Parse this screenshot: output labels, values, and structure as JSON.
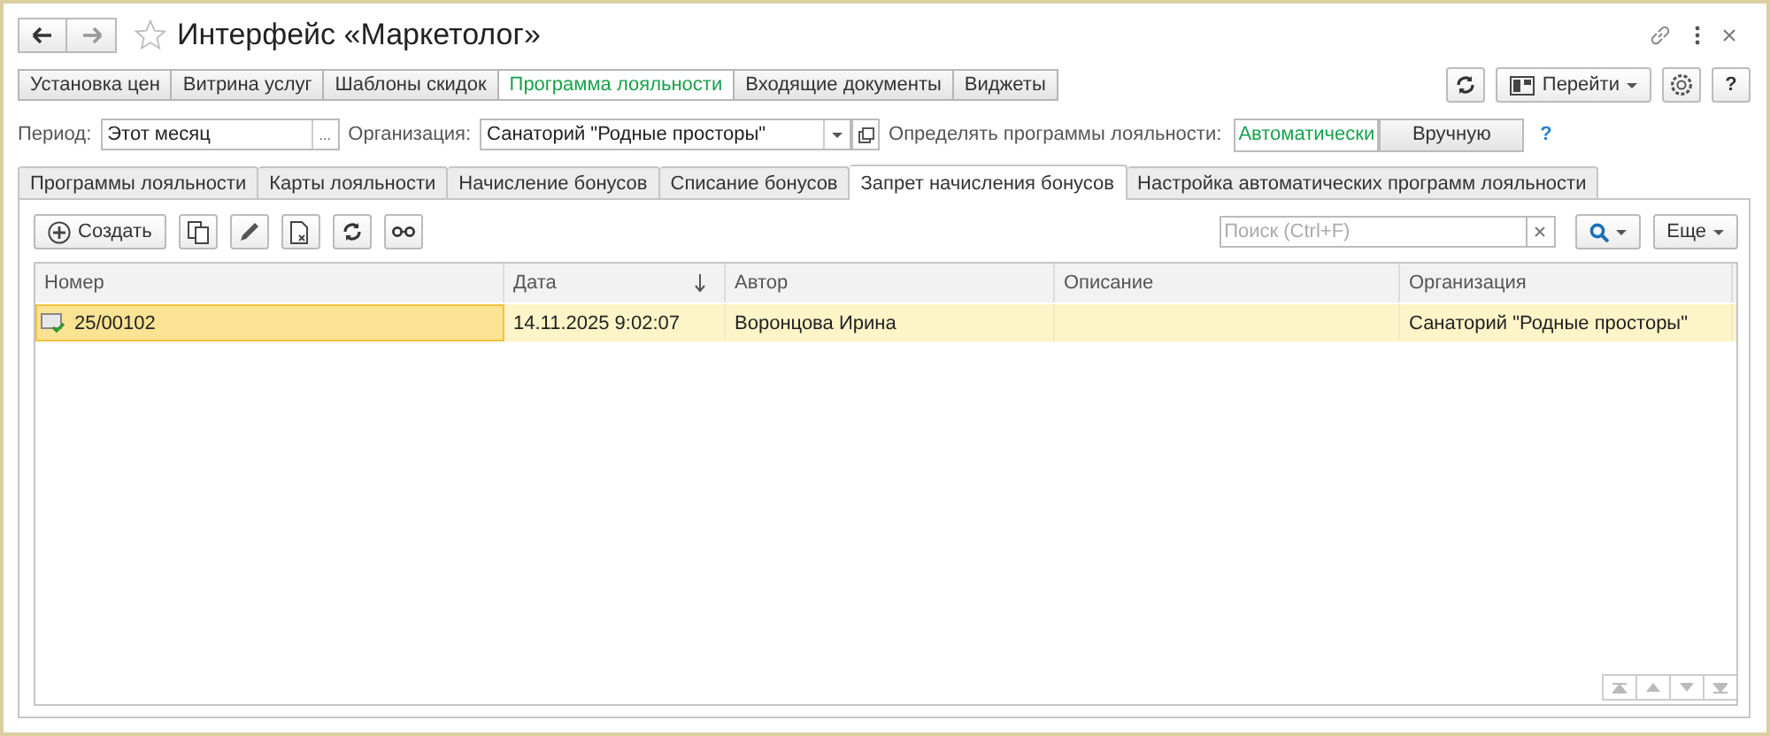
{
  "window": {
    "title": "Интерфейс «Маркетолог»"
  },
  "sections": [
    {
      "label": "Установка цен",
      "selected": false
    },
    {
      "label": "Витрина услуг",
      "selected": false
    },
    {
      "label": "Шаблоны скидок",
      "selected": false
    },
    {
      "label": "Программа лояльности",
      "selected": true
    },
    {
      "label": "Входящие документы",
      "selected": false
    },
    {
      "label": "Виджеты",
      "selected": false
    }
  ],
  "header_buttons": {
    "goto": "Перейти",
    "help": "?"
  },
  "filters": {
    "period_label": "Период:",
    "period_value": "Этот месяц",
    "period_button": "...",
    "organization_label": "Организация:",
    "organization_value": "Санаторий \"Родные просторы\"",
    "mode_label": "Определять программы лояльности:",
    "modes": [
      {
        "label": "Автоматически",
        "selected": true
      },
      {
        "label": "Вручную",
        "selected": false
      }
    ],
    "help": "?"
  },
  "tabs": [
    {
      "label": "Программы лояльности",
      "selected": false
    },
    {
      "label": "Карты лояльности",
      "selected": false
    },
    {
      "label": "Начисление бонусов",
      "selected": false
    },
    {
      "label": "Списание бонусов",
      "selected": false
    },
    {
      "label": "Запрет начисления бонусов",
      "selected": true
    },
    {
      "label": "Настройка автоматических программ лояльности",
      "selected": false
    }
  ],
  "toolbar": {
    "create": "Создать",
    "search_placeholder": "Поиск (Ctrl+F)",
    "more": "Еще"
  },
  "table": {
    "columns": [
      {
        "label": "Номер",
        "sorted": false
      },
      {
        "label": "Дата",
        "sorted": true
      },
      {
        "label": "Автор",
        "sorted": false
      },
      {
        "label": "Описание",
        "sorted": false
      },
      {
        "label": "Организация",
        "sorted": false
      }
    ],
    "rows": [
      {
        "selected": true,
        "cells": [
          "25/00102",
          "14.11.2025 9:02:07",
          "Воронцова Ирина",
          "",
          "Санаторий \"Родные просторы\""
        ]
      }
    ]
  }
}
